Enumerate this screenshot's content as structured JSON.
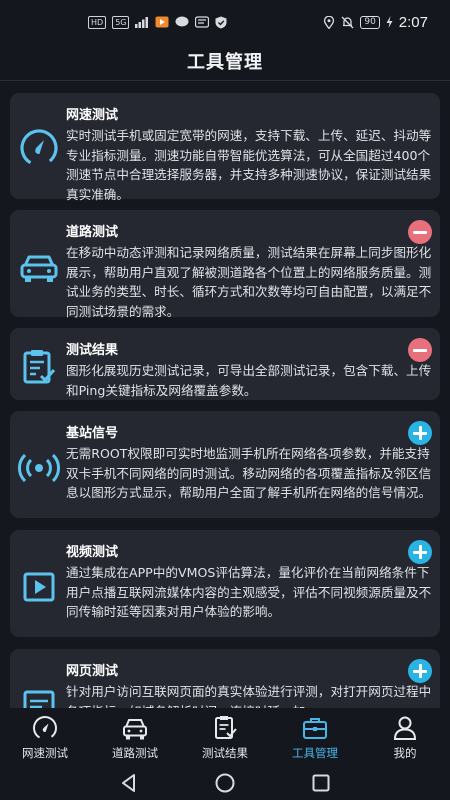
{
  "status_bar": {
    "left_badges": [
      "HD",
      "5G"
    ],
    "battery": "90",
    "time": "2:07"
  },
  "header": {
    "title": "工具管理"
  },
  "tools": [
    {
      "title": "网速测试",
      "icon": "speedometer-icon",
      "action": null,
      "description": "实时测试手机或固定宽带的网速，支持下载、上传、延迟、抖动等专业指标测量。测速功能自带智能优选算法，可从全国超过400个测速节点中合理选择服务器，并支持多种测速协议，保证测试结果真实准确。"
    },
    {
      "title": "道路测试",
      "icon": "car-icon",
      "action": "remove",
      "description": "在移动中动态评测和记录网络质量，测试结果在屏幕上同步图形化展示，帮助用户直观了解被测道路各个位置上的网络服务质量。测试业务的类型、时长、循环方式和次数等均可自由配置，以满足不同测试场景的需求。"
    },
    {
      "title": "测试结果",
      "icon": "clipboard-check-icon",
      "action": "remove",
      "description": "图形化展现历史测试记录，可导出全部测试记录，包含下载、上传和Ping关键指标及网络覆盖参数。"
    },
    {
      "title": "基站信号",
      "icon": "signal-broadcast-icon",
      "action": "add",
      "description": "无需ROOT权限即可实时地监测手机所在网络各项参数，并能支持双卡手机不同网络的同时测试。移动网络的各项覆盖指标及邻区信息以图形方式显示，帮助用户全面了解手机所在网络的信号情况。"
    },
    {
      "title": "视频测试",
      "icon": "video-play-icon",
      "action": "add",
      "description": "通过集成在APP中的VMOS评估算法，量化评价在当前网络条件下用户点播互联网流媒体内容的主观感受，评估不同视频源质量及不同传输时延等因素对用户体验的影响。"
    },
    {
      "title": "网页测试",
      "icon": "webpage-icon",
      "action": "add",
      "description": "针对用户访问互联网页面的真实体验进行评测，对打开网页过程中各项指标，如域名解析时间、连接时延、加"
    }
  ],
  "bottom_nav": [
    {
      "label": "网速测试",
      "icon": "speedometer-icon"
    },
    {
      "label": "道路测试",
      "icon": "car-icon"
    },
    {
      "label": "测试结果",
      "icon": "clipboard-check-icon"
    },
    {
      "label": "工具管理",
      "icon": "toolbox-icon",
      "active": true
    },
    {
      "label": "我的",
      "icon": "user-icon"
    }
  ],
  "colors": {
    "background": "#14171d",
    "card": "#252830",
    "accent": "#2ab4e6",
    "remove": "#e8707c",
    "icon": "#5cc3ee"
  }
}
